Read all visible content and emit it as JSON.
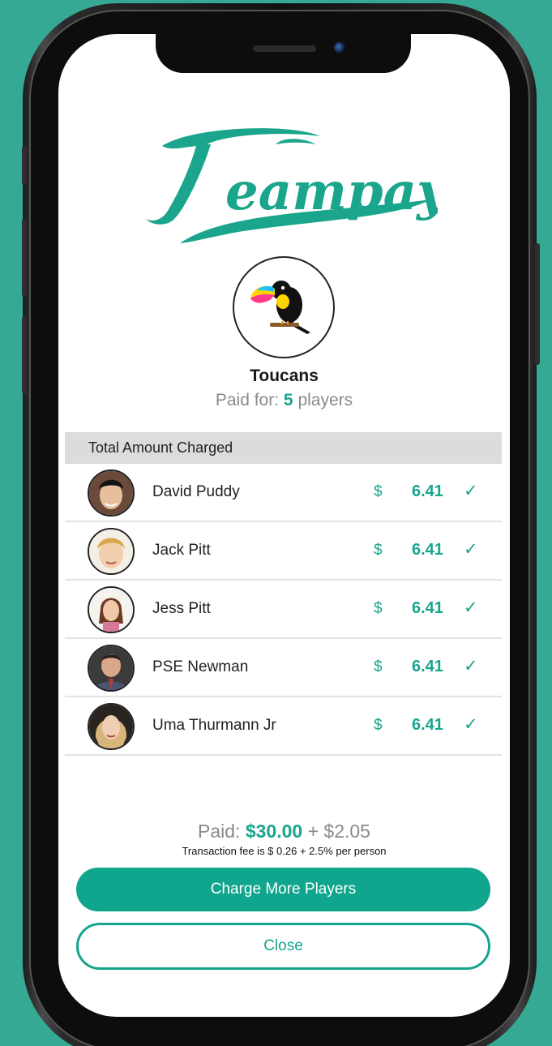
{
  "brand": {
    "logo_text": "Teampay",
    "accent_color": "#1aa58c",
    "background_color": "#36a995"
  },
  "team": {
    "name": "Toucans",
    "avatar_icon": "toucan-icon",
    "paid_for_prefix": "Paid for:",
    "paid_for_count": "5",
    "paid_for_suffix": "players"
  },
  "charges": {
    "header": "Total Amount Charged",
    "players": [
      {
        "name": "David Puddy",
        "currency": "$",
        "amount": "6.41",
        "status_icon": "check-icon",
        "status": "✓"
      },
      {
        "name": "Jack Pitt",
        "currency": "$",
        "amount": "6.41",
        "status_icon": "check-icon",
        "status": "✓"
      },
      {
        "name": "Jess Pitt",
        "currency": "$",
        "amount": "6.41",
        "status_icon": "check-icon",
        "status": "✓"
      },
      {
        "name": "PSE Newman",
        "currency": "$",
        "amount": "6.41",
        "status_icon": "check-icon",
        "status": "✓"
      },
      {
        "name": "Uma Thurmann Jr",
        "currency": "$",
        "amount": "6.41",
        "status_icon": "check-icon",
        "status": "✓"
      }
    ]
  },
  "summary": {
    "paid_label": "Paid:",
    "paid_amount": "$30.00",
    "fee_amount": "+ $2.05",
    "fee_note": "Transaction fee is $ 0.26 + 2.5% per person"
  },
  "actions": {
    "charge_more_label": "Charge More Players",
    "close_label": "Close"
  }
}
